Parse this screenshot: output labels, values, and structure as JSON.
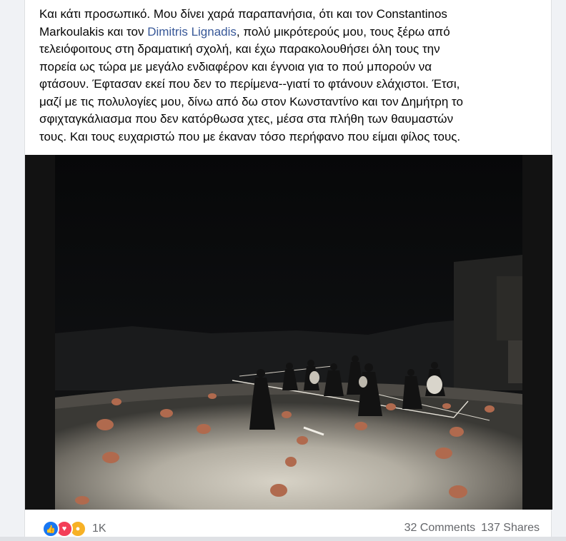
{
  "post": {
    "text_lines": [
      "Και κάτι προσωπικό.  Μου δίνει χαρά παραπανήσια, ότι και τον Constantinos",
      "Markoulakis και τον ",
      ", πολύ μικρότερούς μου, τους ξέρω από",
      "τελειόφοιτους στη δραματική σχολή, και έχω παρακολουθήσει όλη τους την",
      "πορεία ως τώρα με μεγάλο ενδιαφέρον και έγνοια για το πού μπορούν να",
      "φτάσουν. Έφτασαν εκεί που δεν το περίμενα--γιατί το φτάνουν ελάχιστοι. Έτσι,",
      "μαζί με τις πολυλογίες μου, δίνω από δω στον  Κωνσταντίνο και τον Δημήτρη το",
      "σφιχταγκάλιασμα που δεν κατόρθωσα χτες, μέσα στα πλήθη των θαυμαστών",
      "τους.  Και τους ευχαριστώ που με έκαναν τόσο περήφανο που είμαι φίλος τους."
    ],
    "mention": "Dimitris Lignadis"
  },
  "footer": {
    "reaction_icons": [
      "like-icon",
      "love-icon",
      "wow-icon"
    ],
    "reaction_count": "1K",
    "comments": "32 Comments",
    "shares": "137 Shares"
  },
  "colors": {
    "link": "#385898",
    "like": "#1877f2",
    "love": "#f33e58",
    "wow": "#f7b125",
    "muted": "#65676b"
  }
}
